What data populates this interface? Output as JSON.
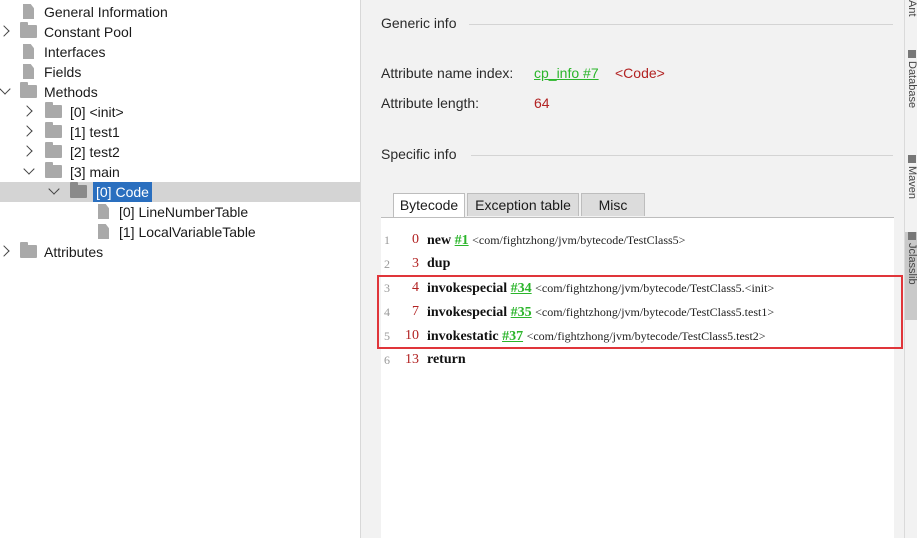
{
  "tree": {
    "items": [
      {
        "label": "General Information"
      },
      {
        "label": "Constant Pool"
      },
      {
        "label": "Interfaces"
      },
      {
        "label": "Fields"
      },
      {
        "label": "Methods"
      },
      {
        "label": "[0] <init>"
      },
      {
        "label": "[1] test1"
      },
      {
        "label": "[2] test2"
      },
      {
        "label": "[3] main"
      },
      {
        "label": "[0] Code"
      },
      {
        "label": "[0] LineNumberTable"
      },
      {
        "label": "[1] LocalVariableTable"
      },
      {
        "label": "Attributes"
      }
    ]
  },
  "panel": {
    "generic_title": "Generic info",
    "attr_name_label": "Attribute name index:",
    "attr_name_link": "cp_info #7",
    "attr_name_value": "<Code>",
    "attr_length_label": "Attribute length:",
    "attr_length_value": "64",
    "specific_title": "Specific info",
    "tabs": [
      {
        "label": "Bytecode"
      },
      {
        "label": "Exception table"
      },
      {
        "label": "Misc"
      }
    ],
    "code": [
      {
        "line": "1",
        "offset": "0",
        "op": "new",
        "ref": "#1",
        "comment": "<com/fightzhong/jvm/bytecode/TestClass5>"
      },
      {
        "line": "2",
        "offset": "3",
        "op": "dup",
        "ref": "",
        "comment": ""
      },
      {
        "line": "3",
        "offset": "4",
        "op": "invokespecial",
        "ref": "#34",
        "comment": "<com/fightzhong/jvm/bytecode/TestClass5.<init>"
      },
      {
        "line": "4",
        "offset": "7",
        "op": "invokespecial",
        "ref": "#35",
        "comment": "<com/fightzhong/jvm/bytecode/TestClass5.test1>"
      },
      {
        "line": "5",
        "offset": "10",
        "op": "invokestatic",
        "ref": "#37",
        "comment": "<com/fightzhong/jvm/bytecode/TestClass5.test2>"
      },
      {
        "line": "6",
        "offset": "13",
        "op": "return",
        "ref": "",
        "comment": ""
      }
    ]
  },
  "side_strip": {
    "tabs": [
      {
        "label": "Ant"
      },
      {
        "label": "Database"
      },
      {
        "label": "Maven"
      },
      {
        "label": "Jclasslib"
      }
    ]
  },
  "colors": {
    "accent_selection": "#2a6fbf",
    "link": "#2bb52b",
    "value_red": "#b22222",
    "highlight_box": "#e0353a"
  }
}
